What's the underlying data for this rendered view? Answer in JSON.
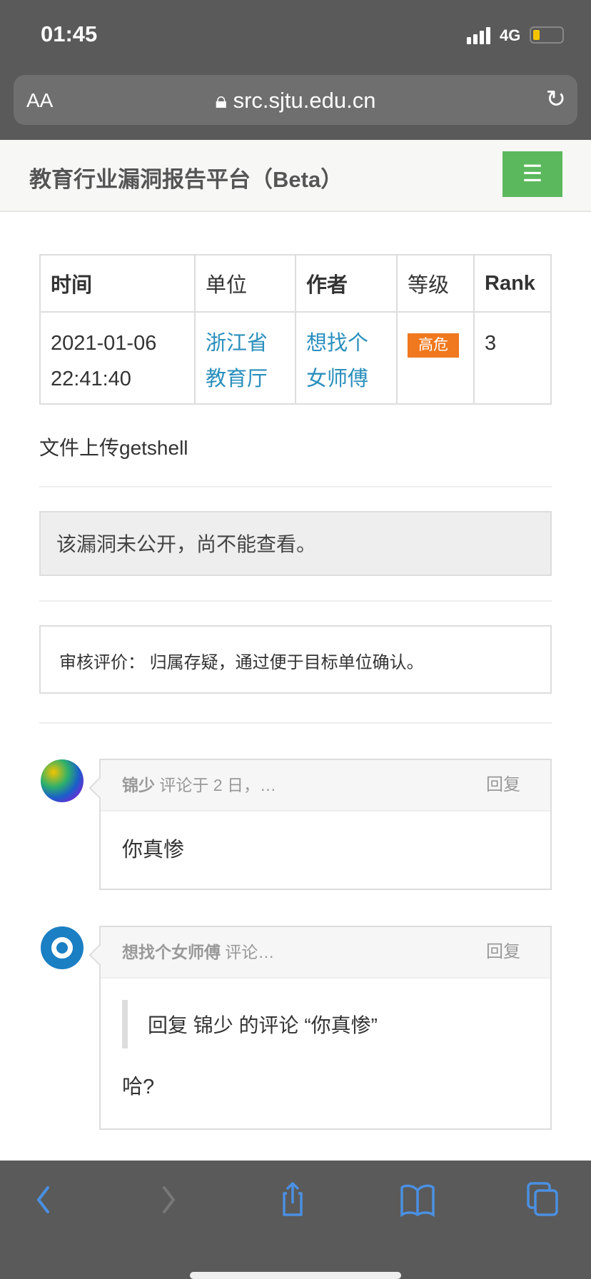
{
  "status_bar": {
    "time": "01:45",
    "network": "4G",
    "battery_level": 0.2
  },
  "browser": {
    "text_size_label": "AA",
    "url": "src.sjtu.edu.cn"
  },
  "site": {
    "title": "教育行业漏洞报告平台（Beta）",
    "menu_icon": "hamburger-icon",
    "accent": "#5cb85c"
  },
  "table": {
    "headers": [
      "时间",
      "单位",
      "作者",
      "等级",
      "Rank"
    ],
    "row": {
      "date": "2021-01-06",
      "time": "22:41:40",
      "unit_line1": "浙江省",
      "unit_line2": "教育厅",
      "author_line1": "想找个",
      "author_line2": "女师傅",
      "level": "高危",
      "rank": "3"
    }
  },
  "vuln_title": "文件上传getshell",
  "notice": "该漏洞未公开，尚不能查看。",
  "review": {
    "label": "审核评价：",
    "text": " 归属存疑，通过便于目标单位确认。"
  },
  "comments": [
    {
      "author": "锦少",
      "meta": " 评论于 2 日，…",
      "reply": "回复",
      "body": "你真惨"
    },
    {
      "author": "想找个女师傅",
      "meta": " 评论…",
      "reply": "回复",
      "quote": "回复 锦少 的评论 “你真惨”",
      "body": "哈?"
    }
  ]
}
